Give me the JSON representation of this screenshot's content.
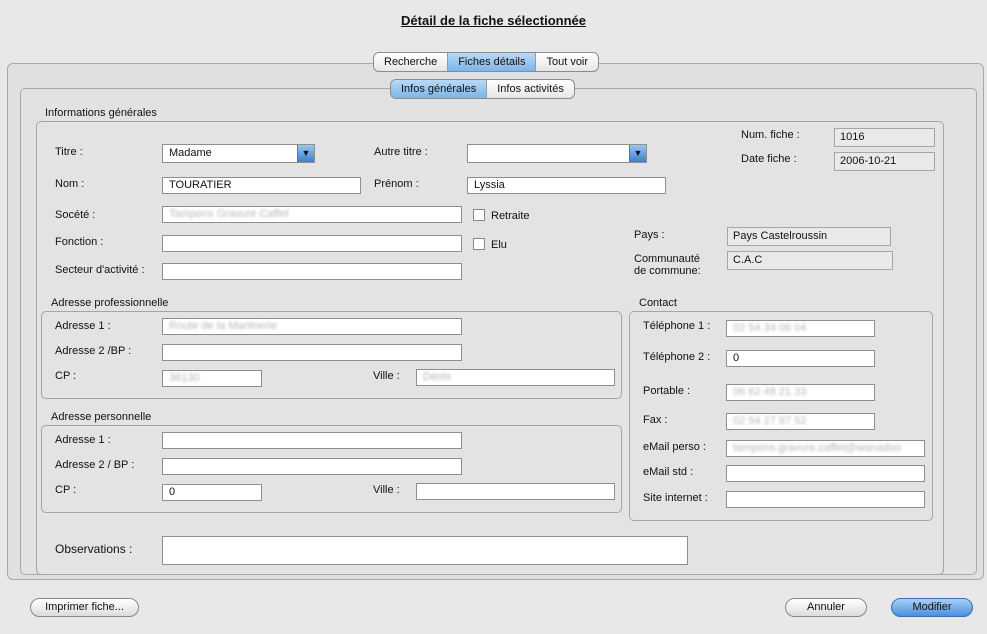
{
  "title": "Détail de la fiche sélectionnée",
  "main_tabs": [
    "Recherche",
    "Fiches détails",
    "Tout voir"
  ],
  "sub_tabs": [
    "Infos générales",
    "Infos activités"
  ],
  "general": {
    "group_title": "Informations générales",
    "titre_label": "Titre :",
    "titre_value": "Madame",
    "autre_titre_label": "Autre titre :",
    "autre_titre_value": "",
    "nom_label": "Nom :",
    "nom_value": "TOURATIER",
    "prenom_label": "Prénom :",
    "prenom_value": "Lyssia",
    "societe_label": "Socété :",
    "societe_value": "Tampons Gravure Caffet",
    "retraite_label": "Retraite",
    "fonction_label": "Fonction :",
    "fonction_value": "",
    "elu_label": "Elu",
    "secteur_label": "Secteur d'activité :",
    "secteur_value": "",
    "num_fiche_label": "Num. fiche :",
    "num_fiche_value": "1016",
    "date_fiche_label": "Date fiche :",
    "date_fiche_value": "2006-10-21",
    "pays_label": "Pays :",
    "pays_value": "Pays Castelroussin",
    "communaute_label_1": "Communauté",
    "communaute_label_2": "de commune:",
    "communaute_value": "C.A.C"
  },
  "pro": {
    "title": "Adresse professionnelle",
    "adresse1_label": "Adresse 1 :",
    "adresse1_value": "Route de la Martinerie",
    "adresse2_label": "Adresse 2 /BP :",
    "adresse2_value": "",
    "cp_label": "CP :",
    "cp_value": "36130",
    "ville_label": "Ville :",
    "ville_value": "Déols"
  },
  "perso": {
    "title": "Adresse personnelle",
    "adresse1_label": "Adresse 1 :",
    "adresse1_value": "",
    "adresse2_label": "Adresse 2 / BP :",
    "adresse2_value": "",
    "cp_label": "CP :",
    "cp_value": "0",
    "ville_label": "Ville :",
    "ville_value": ""
  },
  "contact": {
    "title": "Contact",
    "tel1_label": "Téléphone 1 :",
    "tel1_value": "02 54 34 06 04",
    "tel2_label": "Téléphone 2 :",
    "tel2_value": "0",
    "portable_label": "Portable :",
    "portable_value": "06 62 48 21 33",
    "fax_label": "Fax :",
    "fax_value": "02 54 27 97 52",
    "email_perso_label": "eMail perso :",
    "email_perso_value": "tampons.gravure.caffet@wanadoo",
    "email_std_label": "eMail std :",
    "email_std_value": "",
    "site_label": "Site internet :",
    "site_value": ""
  },
  "observations_label": "Observations :",
  "observations_value": "",
  "buttons": {
    "print": "Imprimer fiche...",
    "cancel": "Annuler",
    "modify": "Modifier"
  }
}
